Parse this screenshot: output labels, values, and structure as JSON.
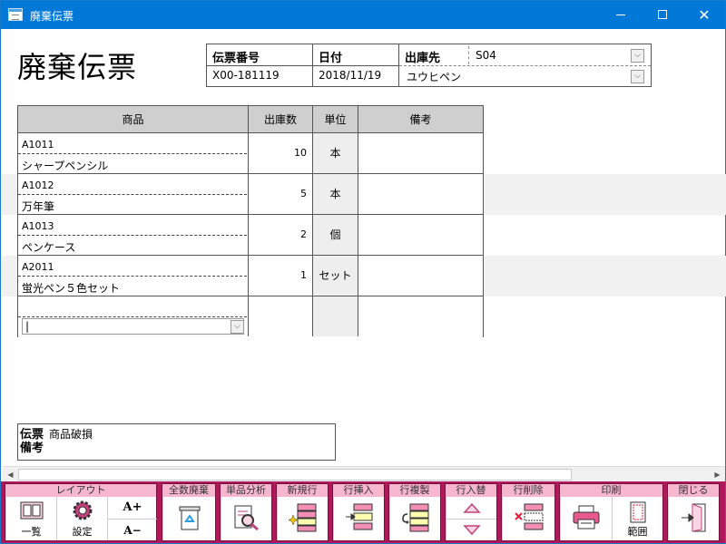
{
  "window": {
    "title": "廃棄伝票",
    "minimize": "",
    "maximize": "",
    "close": "✕"
  },
  "heading": "廃棄伝票",
  "header": {
    "slip_no_label": "伝票番号",
    "slip_no": "X00-181119",
    "date_label": "日付",
    "date": "2018/11/19",
    "dest_label": "出庫先",
    "dest_code": "S04",
    "dest_name": "ユウヒペン"
  },
  "grid": {
    "columns": [
      "商品",
      "出庫数",
      "単位",
      "備考"
    ],
    "rows": [
      {
        "code": "A1011",
        "name": "シャープペンシル",
        "qty": "10",
        "unit": "本",
        "note": ""
      },
      {
        "code": "A1012",
        "name": "万年筆",
        "qty": "5",
        "unit": "本",
        "note": ""
      },
      {
        "code": "A1013",
        "name": "ペンケース",
        "qty": "2",
        "unit": "個",
        "note": ""
      },
      {
        "code": "A2011",
        "name": "蛍光ペン５色セット",
        "qty": "1",
        "unit": "セット",
        "note": ""
      }
    ],
    "new_row_value": "|"
  },
  "remarks": {
    "label": "伝票備考",
    "text": "商品破損"
  },
  "toolbar": {
    "layout": {
      "title": "レイアウト",
      "list": "一覧",
      "settings": "設定",
      "font_up": "A+",
      "font_down": "A−"
    },
    "discard_all": {
      "title": "全数廃棄"
    },
    "analysis": {
      "title": "単品分析"
    },
    "new_row": {
      "title": "新規行"
    },
    "insert_row": {
      "title": "行挿入"
    },
    "copy_row": {
      "title": "行複製"
    },
    "swap_row": {
      "title": "行入替"
    },
    "delete_row": {
      "title": "行削除"
    },
    "print": {
      "title": "印刷",
      "range": "範囲"
    },
    "close": {
      "title": "閉じる"
    }
  },
  "colors": {
    "titlebar": "#0078d7",
    "toolbar": "#b0185c",
    "toolbar_header": "#f6b6cd",
    "grid_header": "#cfcfcf"
  }
}
